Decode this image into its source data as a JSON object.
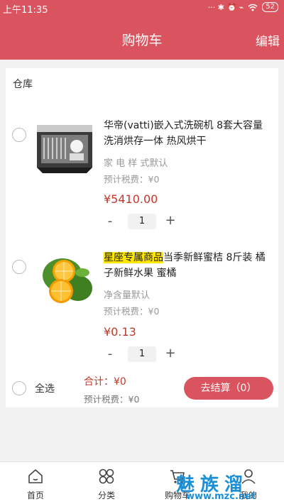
{
  "status_bar": {
    "time": "上午11:35",
    "icons": "··· ✱ ⏰ ⌁",
    "battery": "52"
  },
  "header": {
    "title": "购物车",
    "edit_label": "编辑"
  },
  "cart": {
    "warehouse": "仓库",
    "items": [
      {
        "title": "华帝(vatti)嵌入式洗碗机 8套大容量 洗消烘存一体 热风烘干",
        "tag": "",
        "spec": "家 电 样 式默认",
        "tax": "预计税费：¥0",
        "price": "¥5410.00",
        "quantity": "1"
      },
      {
        "title": "当季新鲜蜜桔 8斤装 橘子新鲜水果 蜜橘",
        "tag": "星座专属商品",
        "spec": "净含量默认",
        "tax": "预计税费：¥0",
        "price": "¥0.13",
        "quantity": "1"
      }
    ],
    "select_all_label": "全选",
    "total": "合计：¥0",
    "total_tax": "预计税费：¥0",
    "checkout_label": "去结算（0）"
  },
  "stepper": {
    "minus": "-",
    "plus": "+"
  },
  "bottom_nav": [
    {
      "label": "首页",
      "icon": "home-icon"
    },
    {
      "label": "分类",
      "icon": "category-icon"
    },
    {
      "label": "购物车",
      "icon": "cart-icon"
    },
    {
      "label": "我的",
      "icon": "user-icon"
    }
  ],
  "watermark": {
    "main": "魅族溜",
    "sub": "www.mzc.net"
  }
}
